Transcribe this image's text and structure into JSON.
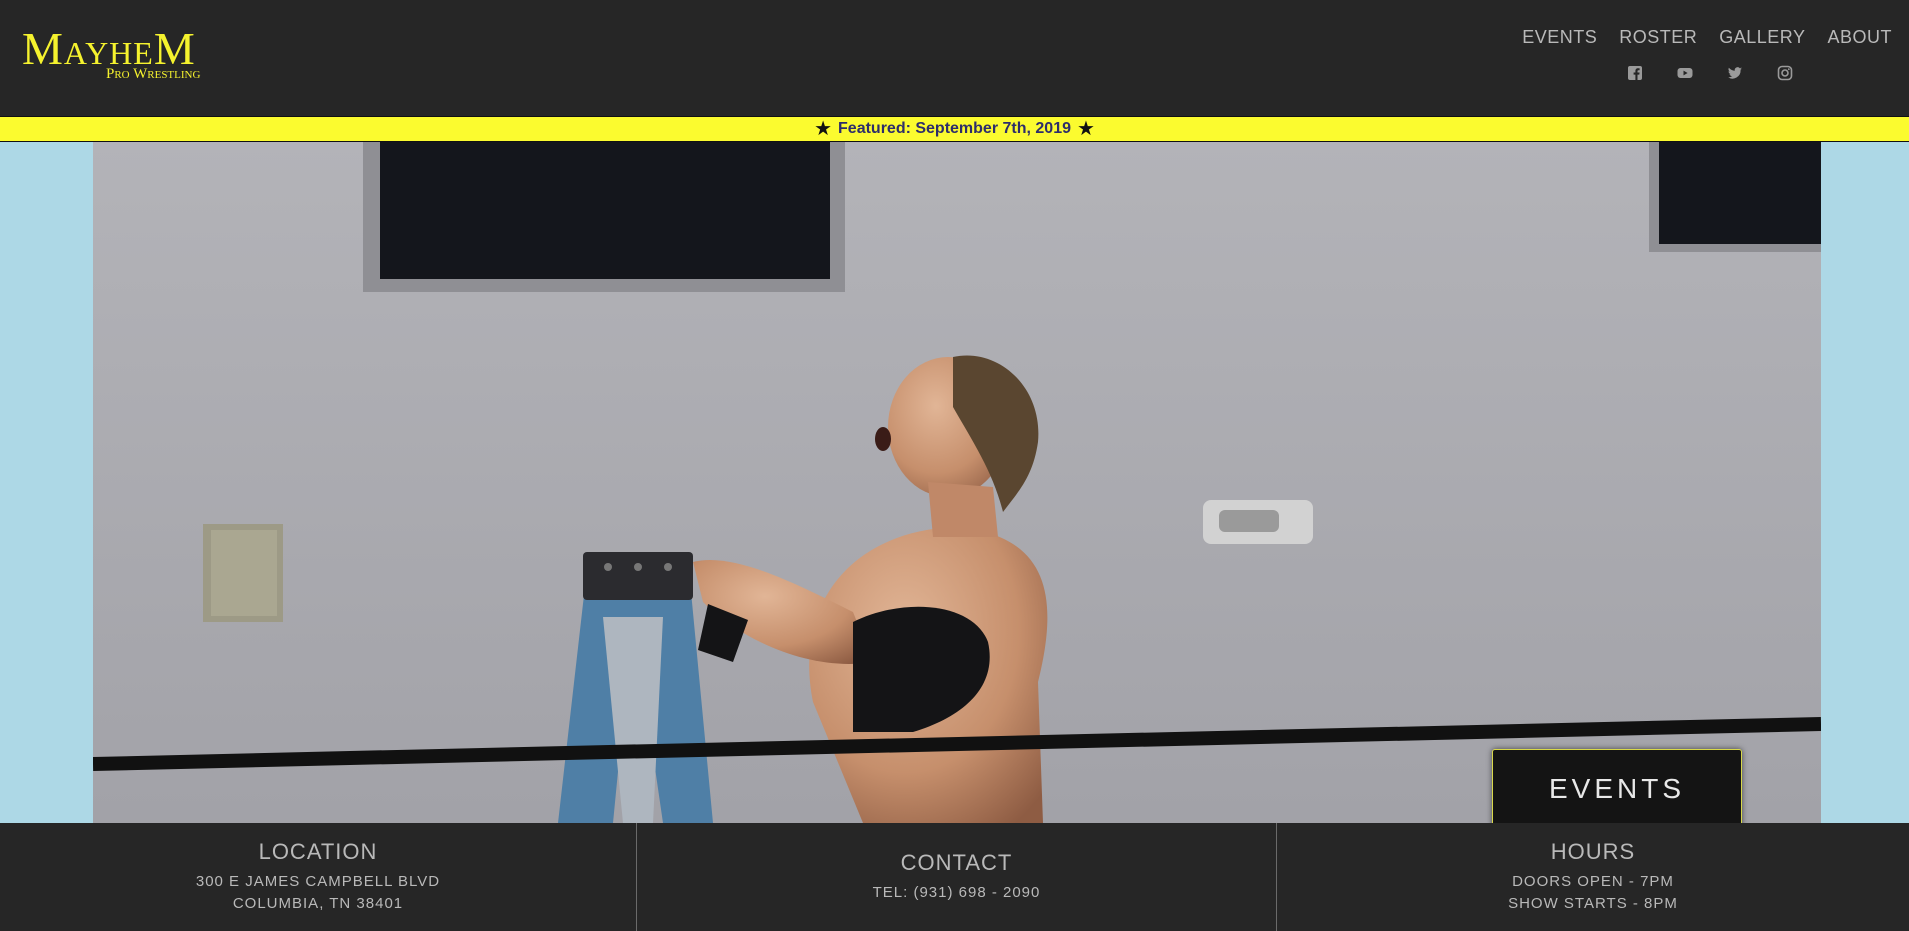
{
  "brand": {
    "name": "MayheM",
    "tagline": "Pro Wrestling",
    "color": "#f5f22e"
  },
  "nav": {
    "items": [
      {
        "label": "EVENTS"
      },
      {
        "label": "ROSTER"
      },
      {
        "label": "GALLERY"
      },
      {
        "label": "ABOUT"
      }
    ]
  },
  "social": [
    {
      "icon": "facebook-icon"
    },
    {
      "icon": "youtube-icon"
    },
    {
      "icon": "twitter-icon"
    },
    {
      "icon": "instagram-icon"
    }
  ],
  "featured": {
    "text": "Featured: September 7th, 2019",
    "background": "#fbfb2f"
  },
  "hero": {
    "cta_label": "EVENTS",
    "image": "wrestler-on-ladder-photo"
  },
  "footer": {
    "location": {
      "title": "LOCATION",
      "line1": "300 E JAMES CAMPBELL BLVD",
      "line2": "COLUMBIA, TN 38401"
    },
    "contact": {
      "title": "CONTACT",
      "line1": "TEL: (931) 698 - 2090"
    },
    "hours": {
      "title": "HOURS",
      "line1": "DOORS OPEN - 7PM",
      "line2": "SHOW STARTS - 8PM"
    }
  }
}
